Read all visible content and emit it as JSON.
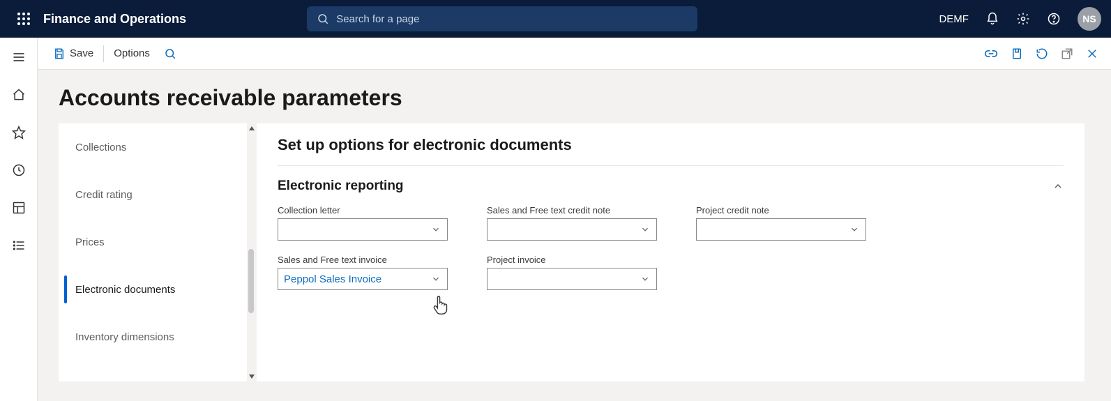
{
  "header": {
    "app_title": "Finance and Operations",
    "search_placeholder": "Search for a page",
    "company": "DEMF",
    "avatar_initials": "NS"
  },
  "action_bar": {
    "save_label": "Save",
    "options_label": "Options"
  },
  "page": {
    "title": "Accounts receivable parameters",
    "detail_title": "Set up options for electronic documents",
    "section_title": "Electronic reporting"
  },
  "tabs": {
    "items": [
      {
        "label": "Collections",
        "active": false
      },
      {
        "label": "Credit rating",
        "active": false
      },
      {
        "label": "Prices",
        "active": false
      },
      {
        "label": "Electronic documents",
        "active": true
      },
      {
        "label": "Inventory dimensions",
        "active": false
      }
    ]
  },
  "fields": {
    "collection_letter": {
      "label": "Collection letter",
      "value": ""
    },
    "sales_credit_note": {
      "label": "Sales and Free text credit note",
      "value": ""
    },
    "project_credit_note": {
      "label": "Project credit note",
      "value": ""
    },
    "sales_invoice": {
      "label": "Sales and Free text invoice",
      "value": "Peppol Sales Invoice"
    },
    "project_invoice": {
      "label": "Project invoice",
      "value": ""
    }
  }
}
